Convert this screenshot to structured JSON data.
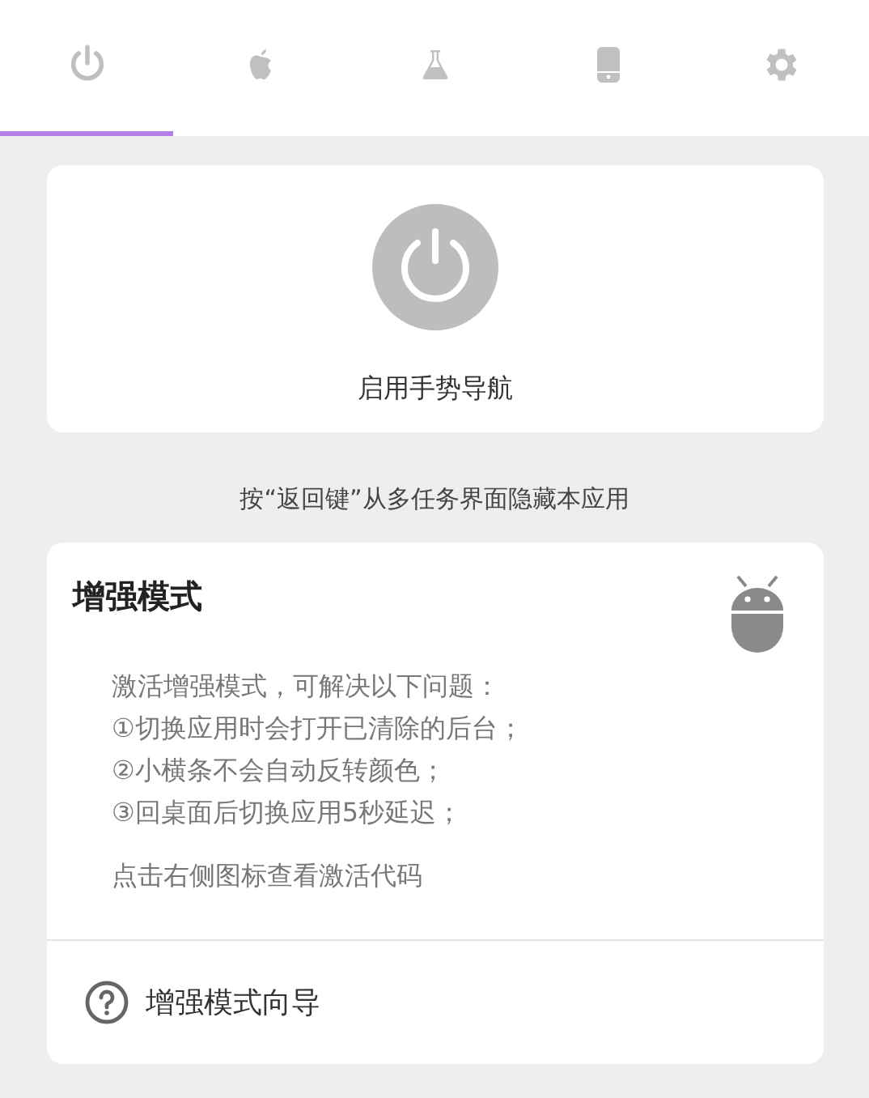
{
  "tabs": [
    {
      "selected": true
    },
    {
      "selected": false
    },
    {
      "selected": false
    },
    {
      "selected": false
    },
    {
      "selected": false
    }
  ],
  "gesture_card": {
    "label": "启用手势导航",
    "on": false
  },
  "hint": "按“返回键”从多任务界面隐藏本应用",
  "enhanced_card": {
    "title": "增强模式",
    "description": [
      "激活增强模式，可解决以下问题：",
      "①切换应用时会打开已清除的后台；",
      "②小横条不会自动反转颜色；",
      "③回桌面后切换应用5秒延迟；"
    ],
    "footnote": "点击右侧图标查看激活代码",
    "guide": "增强模式向导"
  }
}
